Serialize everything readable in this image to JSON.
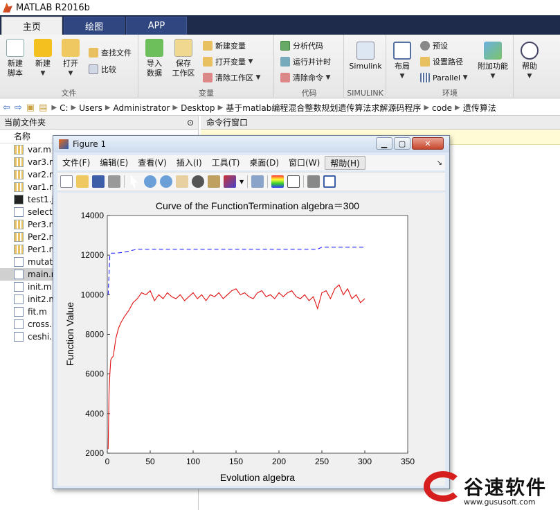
{
  "app": {
    "title": "MATLAB R2016b"
  },
  "tabs": [
    {
      "label": "主页"
    },
    {
      "label": "绘图"
    },
    {
      "label": "APP"
    }
  ],
  "ribbon": {
    "file": {
      "label": "文件",
      "new_script": "新建\n脚本",
      "new": "新建",
      "open": "打开",
      "find_files": "查找文件",
      "compare": "比较"
    },
    "variable": {
      "label": "变量",
      "import": "导入\n数据",
      "save_workspace": "保存\n工作区",
      "new_variable": "新建变量",
      "open_variable": "打开变量",
      "clear_workspace": "清除工作区"
    },
    "code": {
      "label": "代码",
      "analyze": "分析代码",
      "run_time": "运行并计时",
      "clear_commands": "清除命令"
    },
    "simulink": {
      "label": "SIMULINK",
      "simulink": "Simulink"
    },
    "environment": {
      "label": "环境",
      "layout": "布局",
      "preferences": "预设",
      "set_path": "设置路径",
      "parallel": "Parallel",
      "addons": "附加功能"
    },
    "resources": {
      "help": "帮助"
    }
  },
  "address": {
    "crumbs": [
      "C:",
      "Users",
      "Administrator",
      "Desktop",
      "基于matlab编程混合整数规划遗传算法求解源码程序",
      "code",
      "遗传算法"
    ]
  },
  "left_panel": {
    "title": "当前文件夹",
    "column": "名称",
    "files": [
      {
        "name": "var.m",
        "type": "grid"
      },
      {
        "name": "var3.m",
        "type": "grid"
      },
      {
        "name": "var2.m",
        "type": "grid"
      },
      {
        "name": "var1.m",
        "type": "grid"
      },
      {
        "name": "test1.jpg",
        "type": "fig"
      },
      {
        "name": "select.m",
        "type": "m"
      },
      {
        "name": "Per3.m",
        "type": "grid"
      },
      {
        "name": "Per2.m",
        "type": "grid"
      },
      {
        "name": "Per1.m",
        "type": "grid"
      },
      {
        "name": "mutat",
        "type": "m"
      },
      {
        "name": "main.m",
        "type": "m",
        "selected": true
      },
      {
        "name": "init.m",
        "type": "m"
      },
      {
        "name": "init2.m",
        "type": "m"
      },
      {
        "name": "fit.m",
        "type": "m"
      },
      {
        "name": "cross.m",
        "type": "m"
      },
      {
        "name": "ceshi.m",
        "type": "m"
      }
    ]
  },
  "right_panel": {
    "title": "命令行窗口"
  },
  "figure": {
    "title": "Figure 1",
    "menu": [
      "文件(F)",
      "编辑(E)",
      "查看(V)",
      "插入(I)",
      "工具(T)",
      "桌面(D)",
      "窗口(W)",
      "帮助(H)"
    ]
  },
  "chart_data": {
    "type": "line",
    "title": "Curve of the FunctionTermination algebra＝300",
    "xlabel": "Evolution algebra",
    "ylabel": "Function Value",
    "xlim": [
      0,
      350
    ],
    "ylim": [
      2000,
      14000
    ],
    "xticks": [
      0,
      50,
      100,
      150,
      200,
      250,
      300,
      350
    ],
    "yticks": [
      2000,
      4000,
      6000,
      8000,
      10000,
      12000,
      14000
    ],
    "series": [
      {
        "style": "dashed",
        "color": "#1f1fff",
        "x": [
          1,
          3,
          5,
          10,
          20,
          30,
          35,
          60,
          100,
          150,
          200,
          245,
          250,
          300
        ],
        "values": [
          10000,
          12000,
          12100,
          12100,
          12150,
          12250,
          12300,
          12300,
          12300,
          12300,
          12300,
          12300,
          12400,
          12400
        ]
      },
      {
        "style": "solid",
        "color": "#e01010",
        "x": [
          1,
          2,
          3,
          4,
          5,
          7,
          10,
          13,
          16,
          20,
          25,
          30,
          35,
          40,
          45,
          50,
          55,
          60,
          65,
          70,
          75,
          80,
          85,
          90,
          95,
          100,
          105,
          110,
          115,
          120,
          125,
          130,
          135,
          140,
          145,
          150,
          155,
          160,
          165,
          170,
          175,
          180,
          185,
          190,
          195,
          200,
          205,
          210,
          215,
          220,
          225,
          230,
          235,
          240,
          245,
          250,
          255,
          260,
          265,
          270,
          275,
          280,
          285,
          290,
          295,
          300
        ],
        "values": [
          2200,
          5000,
          6000,
          6700,
          6800,
          6900,
          7800,
          8300,
          8600,
          8900,
          9200,
          9600,
          9800,
          10100,
          10000,
          10200,
          9700,
          10000,
          9800,
          10100,
          9900,
          9800,
          10000,
          9700,
          9900,
          10100,
          9800,
          10000,
          9700,
          10000,
          9900,
          10100,
          9800,
          10000,
          10200,
          10300,
          10000,
          10100,
          9900,
          9800,
          10100,
          10200,
          9900,
          10000,
          9800,
          10100,
          9900,
          10100,
          10200,
          9900,
          9800,
          10000,
          9700,
          9900,
          9300,
          10100,
          10200,
          9800,
          10300,
          10500,
          10000,
          10300,
          9800,
          10000,
          9600,
          9800
        ]
      }
    ]
  },
  "watermark": {
    "name": "谷速软件",
    "url": "www.gususoft.com"
  }
}
